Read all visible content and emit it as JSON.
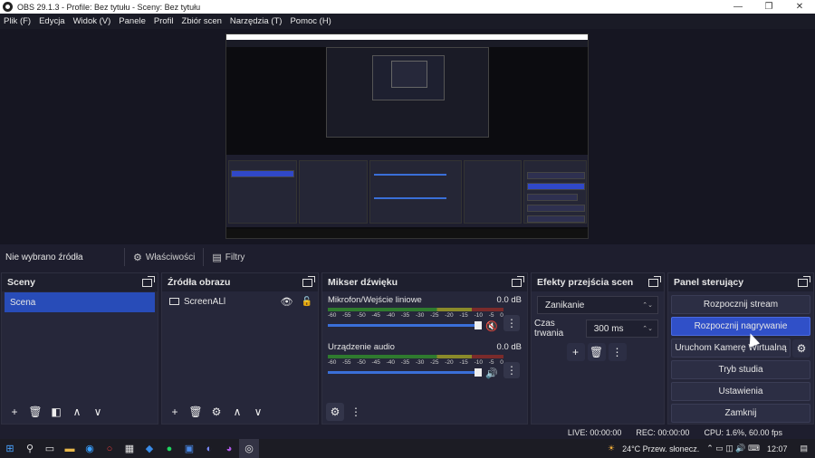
{
  "window": {
    "title": "OBS 29.1.3 - Profile: Bez tytułu - Sceny: Bez tytułu",
    "minimize": "—",
    "maximize": "❐",
    "close": "✕"
  },
  "menu": [
    "Plik (F)",
    "Edycja",
    "Widok (V)",
    "Panele",
    "Profil",
    "Zbiór scen",
    "Narzędzia (T)",
    "Pomoc (H)"
  ],
  "source_bar": {
    "no_source": "Nie wybrano źródła",
    "properties": "Właściwości",
    "filters": "Filtry"
  },
  "scenes": {
    "title": "Sceny",
    "items": [
      "Scena"
    ]
  },
  "sources": {
    "title": "Źródła obrazu",
    "items": [
      "ScreenALl"
    ]
  },
  "mixer": {
    "title": "Mikser dźwięku",
    "channels": [
      {
        "name": "Mikrofon/Wejście liniowe",
        "db": "0.0 dB",
        "muted": true,
        "level": 0.95
      },
      {
        "name": "Urządzenie audio",
        "db": "0.0 dB",
        "muted": false,
        "level": 0.95
      }
    ],
    "ticks": [
      "-60",
      "-55",
      "-50",
      "-45",
      "-40",
      "-35",
      "-30",
      "-25",
      "-20",
      "-15",
      "-10",
      "-5",
      "0"
    ]
  },
  "transitions": {
    "title": "Efekty przejścia scen",
    "selected": "Zanikanie",
    "duration_label": "Czas trwania",
    "duration": "300 ms"
  },
  "controls": {
    "title": "Panel sterujący",
    "buttons": [
      "Rozpocznij stream",
      "Rozpocznij nagrywanie",
      "Uruchom Kamerę Wirtualną",
      "Tryb studia",
      "Ustawienia",
      "Zamknij"
    ]
  },
  "status": {
    "live": "LIVE: 00:00:00",
    "rec": "REC: 00:00:00",
    "cpu": "CPU: 1.6%, 60.00 fps"
  },
  "taskbar": {
    "weather": "24°C  Przew. słonecz.",
    "time": "12:07"
  },
  "colors": {
    "accent": "#3050c8",
    "panel": "#26273a",
    "background": "#1e1e2e"
  }
}
